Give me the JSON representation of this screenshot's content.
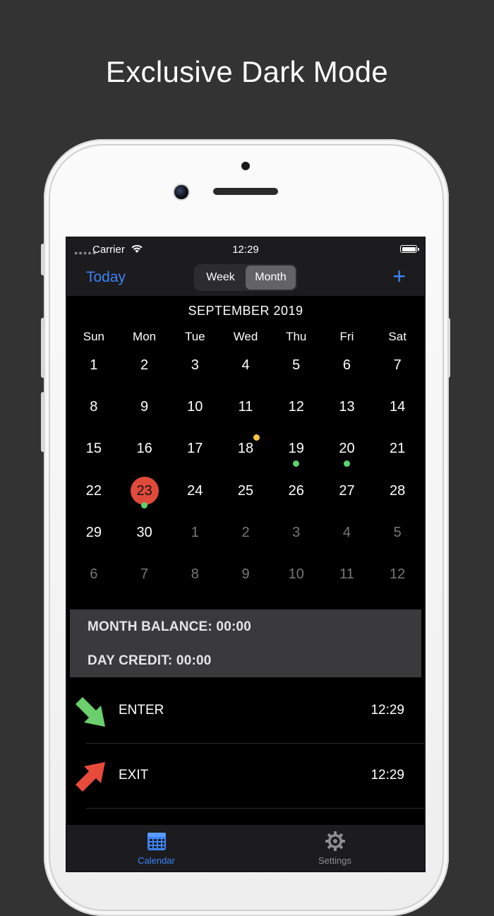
{
  "headline": "Exclusive Dark Mode",
  "status_bar": {
    "carrier": "Carrier",
    "time": "12:29"
  },
  "nav": {
    "today_label": "Today",
    "segments": [
      "Week",
      "Month"
    ],
    "selected_segment": "Month",
    "add_label": "+"
  },
  "calendar": {
    "title": "SEPTEMBER 2019",
    "weekdays": [
      "Sun",
      "Mon",
      "Tue",
      "Wed",
      "Thu",
      "Fri",
      "Sat"
    ],
    "weeks": [
      [
        "1",
        "2",
        "3",
        "4",
        "5",
        "6",
        "7"
      ],
      [
        "8",
        "9",
        "10",
        "11",
        "12",
        "13",
        "14"
      ],
      [
        "15",
        "16",
        "17",
        "18",
        "19",
        "20",
        "21"
      ],
      [
        "22",
        "23",
        "24",
        "25",
        "26",
        "27",
        "28"
      ],
      [
        "29",
        "30",
        "1",
        "2",
        "3",
        "4",
        "5"
      ],
      [
        "6",
        "7",
        "8",
        "9",
        "10",
        "11",
        "12"
      ]
    ],
    "selected_day": "23",
    "markers": {
      "18": "yellow",
      "19": "green",
      "20": "green",
      "23": "green"
    }
  },
  "balance": {
    "month_balance": "MONTH BALANCE: 00:00",
    "day_credit": "DAY CREDIT: 00:00"
  },
  "entries": [
    {
      "label": "ENTER",
      "time": "12:29",
      "icon": "green-down-right-arrow-icon"
    },
    {
      "label": "EXIT",
      "time": "12:29",
      "icon": "red-up-right-arrow-icon"
    }
  ],
  "tabs": [
    {
      "label": "Calendar",
      "icon": "calendar-icon",
      "active": true
    },
    {
      "label": "Settings",
      "icon": "gear-icon",
      "active": false
    }
  ],
  "colors": {
    "accent": "#3b82f6",
    "today": "#e04a3b",
    "green_dot": "#5bd36c",
    "yellow_dot": "#f5c542",
    "enter_arrow": "#6bd06b",
    "exit_arrow": "#e84b3a"
  }
}
